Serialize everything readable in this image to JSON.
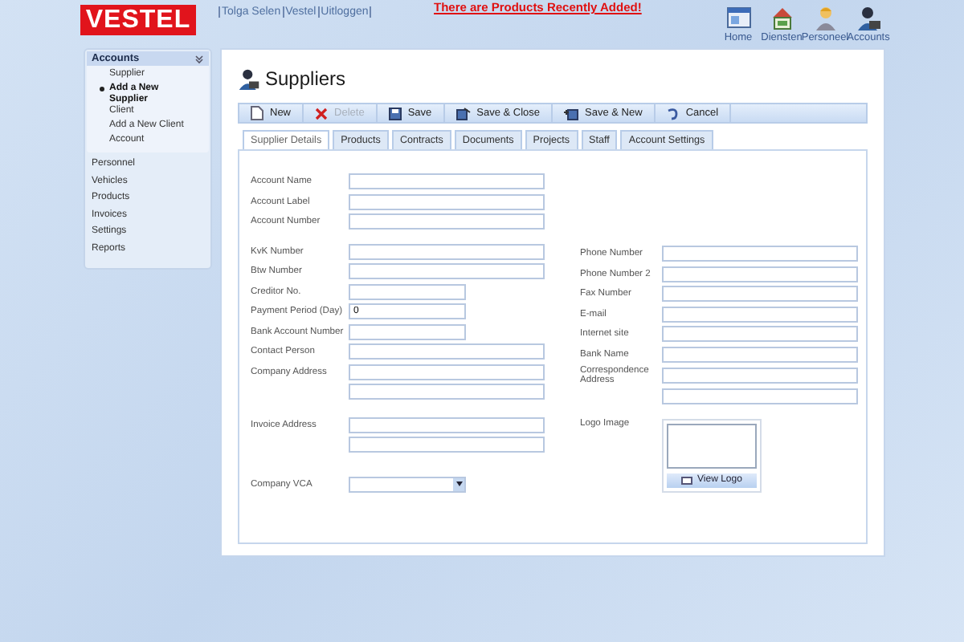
{
  "header": {
    "logo": "VESTEL",
    "user_links": [
      "Tolga Selen",
      "Vestel",
      "Uitloggen"
    ],
    "alert": "There are Products Recently Added!",
    "nav": [
      {
        "label": "Home",
        "kind": "home"
      },
      {
        "label": "Diensten",
        "kind": "services"
      },
      {
        "label": "Personeel",
        "kind": "person"
      },
      {
        "label": "Accounts",
        "kind": "accounts"
      }
    ]
  },
  "sidebar": {
    "section": {
      "title": "Accounts",
      "expanded": true,
      "items": [
        {
          "label": "Supplier",
          "selected": false
        },
        {
          "label": "Add a New Supplier",
          "selected": true
        },
        {
          "label": "Client",
          "selected": false
        },
        {
          "label": "Add a New Client",
          "selected": false
        },
        {
          "label": "Account",
          "selected": false
        }
      ]
    },
    "items": [
      "Personnel",
      "Vehicles",
      "Products",
      "Invoices",
      "Settings",
      "Reports"
    ]
  },
  "page": {
    "title": "Suppliers",
    "toolbar": [
      {
        "label": "New",
        "kind": "new",
        "disabled": false
      },
      {
        "label": "Delete",
        "kind": "delete",
        "disabled": true
      },
      {
        "label": "Save",
        "kind": "save",
        "disabled": false
      },
      {
        "label": "Save & Close",
        "kind": "save-close",
        "disabled": false
      },
      {
        "label": "Save & New",
        "kind": "save-new",
        "disabled": false
      },
      {
        "label": "Cancel",
        "kind": "cancel",
        "disabled": false
      }
    ],
    "tabs": [
      {
        "label": "Supplier Details",
        "selected": true
      },
      {
        "label": "Products",
        "selected": false
      },
      {
        "label": "Contracts",
        "selected": false
      },
      {
        "label": "Documents",
        "selected": false
      },
      {
        "label": "Projects",
        "selected": false
      },
      {
        "label": "Staff",
        "selected": false
      },
      {
        "label": "Account Settings",
        "selected": false
      }
    ],
    "left_groups": [
      [
        {
          "label": "Account Name",
          "kind": "wide"
        },
        {
          "label": "Account Label",
          "kind": "wide"
        },
        {
          "label": "Account Number",
          "kind": "wide"
        }
      ],
      [
        {
          "label": "KvK Number",
          "kind": "wide"
        },
        {
          "label": "Btw Number",
          "kind": "wide"
        },
        {
          "label": "Creditor No.",
          "kind": "short"
        },
        {
          "label": "Payment Period (Day)",
          "kind": "short",
          "value": "0"
        },
        {
          "label": "Bank Account Number",
          "kind": "short"
        },
        {
          "label": "Contact Person",
          "kind": "wide"
        },
        {
          "label": "Company Address",
          "kind": "wide"
        },
        {
          "kind": "wide"
        }
      ],
      [
        {
          "label": "Invoice Address",
          "kind": "wide"
        },
        {
          "kind": "wide"
        }
      ],
      [
        {
          "label": "Company VCA",
          "kind": "select"
        }
      ]
    ],
    "right_fields": [
      {
        "label": "Phone Number",
        "kind": "wide"
      },
      {
        "label": "Phone Number 2",
        "kind": "wide"
      },
      {
        "label": "Fax Number",
        "kind": "wide"
      },
      {
        "label": "E-mail",
        "kind": "wide"
      },
      {
        "label": "Internet site",
        "kind": "wide"
      },
      {
        "label": "Bank Name",
        "kind": "wide"
      },
      {
        "label": "Correspondence Address",
        "kind": "wide"
      },
      {
        "kind": "wide"
      }
    ],
    "logo": {
      "label": "Logo Image",
      "button": "View Logo"
    }
  }
}
